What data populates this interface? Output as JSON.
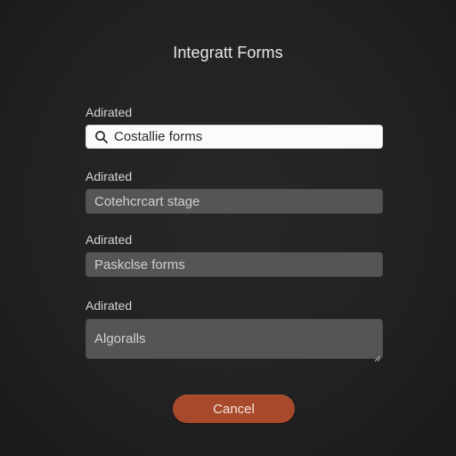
{
  "dialog": {
    "title": "Integratt Forms"
  },
  "fields": [
    {
      "label": "Adirated",
      "value": "Costallie forms",
      "icon": "search-icon"
    },
    {
      "label": "Adirated",
      "value": "Cotehcrcart stage"
    },
    {
      "label": "Adirated",
      "value": "Paskclse forms"
    },
    {
      "label": "Adirated",
      "value": "Algoralls"
    }
  ],
  "actions": {
    "cancel_label": "Cancel"
  },
  "colors": {
    "background": "#1c1c1c",
    "field_fill": "#555555",
    "search_fill": "#fbfbfb",
    "cancel_accent": "#a9492b"
  }
}
